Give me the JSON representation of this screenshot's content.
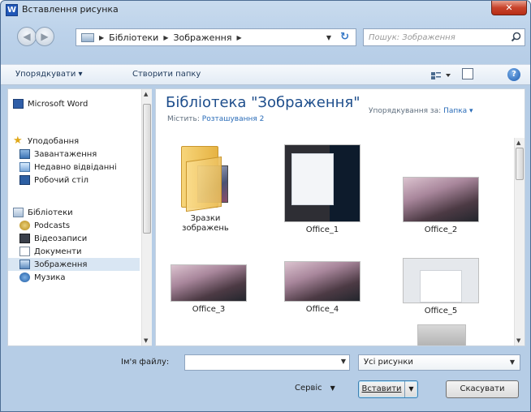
{
  "window": {
    "title": "Вставлення рисунка",
    "app_icon": "W",
    "close": "✕"
  },
  "address": {
    "segments": [
      "Бібліотеки",
      "Зображення"
    ],
    "search_placeholder": "Пошук: Зображення"
  },
  "toolbar": {
    "organize": "Упорядкувати ▾",
    "new_folder": "Створити папку",
    "help": "?"
  },
  "nav": {
    "items": [
      {
        "label": "Microsoft Word",
        "icon": "word-icon"
      },
      {
        "label": "Уподобання",
        "icon": "star-icon"
      },
      {
        "label": "Завантаження",
        "icon": "downloads-icon"
      },
      {
        "label": "Недавно відвіданні",
        "icon": "recent-places-icon"
      },
      {
        "label": "Робочий стіл",
        "icon": "desktop-icon"
      },
      {
        "label": "Бібліотеки",
        "icon": "libraries-icon"
      },
      {
        "label": "Podcasts",
        "icon": "podcast-icon"
      },
      {
        "label": "Відеозаписи",
        "icon": "video-icon"
      },
      {
        "label": "Документи",
        "icon": "documents-icon"
      },
      {
        "label": "Зображення",
        "icon": "pictures-icon",
        "selected": true
      },
      {
        "label": "Музика",
        "icon": "music-icon"
      }
    ]
  },
  "content": {
    "title": "Бібліотека \"Зображення\"",
    "subtitle_prefix": "Містить:",
    "subtitle_link": "Розташування 2",
    "arrange_label": "Упорядкування за:",
    "arrange_value": "Папка ▾",
    "items": [
      {
        "label": "Зразки зображень",
        "kind": "folder"
      },
      {
        "label": "Office_1"
      },
      {
        "label": "Office_2"
      },
      {
        "label": "Office_3"
      },
      {
        "label": "Office_4"
      },
      {
        "label": "Office_5"
      }
    ]
  },
  "bottom": {
    "filename_label": "Ім'я файлу:",
    "filename_value": "",
    "filter_value": "Усі рисунки",
    "tools_label": "Сервіс",
    "insert_label": "Вставити",
    "cancel_label": "Скасувати"
  }
}
